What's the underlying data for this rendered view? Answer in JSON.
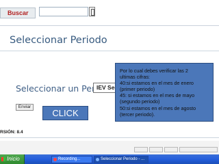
{
  "search": {
    "button_label": "Buscar"
  },
  "page": {
    "title": "Seleccionar Periodo"
  },
  "form": {
    "period_label": "Seleccionar un Periodo:",
    "period_selected": "IEV Seca",
    "submit_label": "Enviar"
  },
  "annotations": {
    "click_label": "CLICK",
    "info_lines": [
      "Por lo cual debes verificar las 2",
      "ultimas cifras:",
      "40:si estamos en el mes de enero",
      "(primer periodo)",
      "45: si estamos en el mes de mayo",
      "(segundo periodo)",
      "50:si estamos en el mes de agosto",
      "(tercer periodo)."
    ]
  },
  "footer": {
    "version_text": "RSIÓN: 8.4"
  },
  "taskbar": {
    "start_label": "Inicio",
    "tasks": [
      {
        "label": "Recording...",
        "icon": "record-icon",
        "active": false
      },
      {
        "label": "Seleccionar Periodo - ...",
        "icon": "browser-icon",
        "active": true
      }
    ]
  },
  "colors": {
    "panel_blue": "#4b77b9",
    "title_blue": "#375a7f",
    "taskbar_blue": "#245edc",
    "start_green": "#3a9a3a"
  }
}
